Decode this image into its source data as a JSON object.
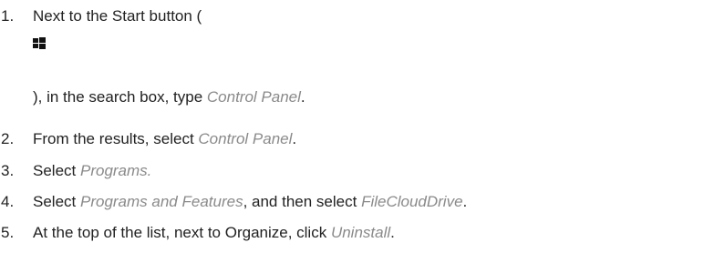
{
  "steps": [
    {
      "number": "1.",
      "line1": "Next to the Start button (",
      "line2_prefix": "), in the search box, type ",
      "line2_emph": "Control Panel",
      "line2_suffix": "."
    },
    {
      "number": "2.",
      "prefix": "From the results, select ",
      "emph": "Control Panel",
      "suffix": "."
    },
    {
      "number": "3.",
      "prefix": "Select ",
      "emph": "Programs.",
      "suffix": ""
    },
    {
      "number": "4.",
      "prefix": "Select ",
      "emph": "Programs and Features",
      "middle": ", and then select ",
      "emph2": "FileCloudDrive",
      "suffix": "."
    },
    {
      "number": "5.",
      "prefix": "At the top of the list, next to Organize, click ",
      "emph": "Uninstall",
      "suffix": "."
    }
  ],
  "icons": {
    "start_icon": "windows-logo-icon"
  },
  "colors": {
    "text": "#222222",
    "emphasis": "#8a8a8a"
  }
}
